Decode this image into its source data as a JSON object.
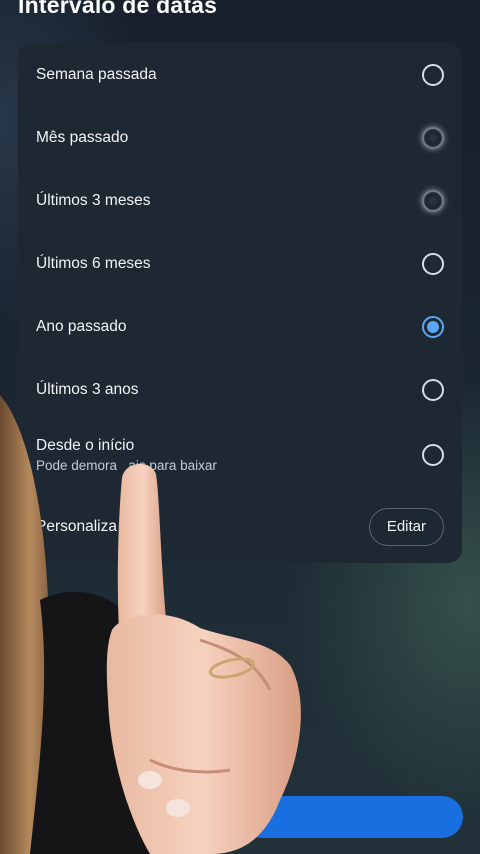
{
  "header": {
    "title": "Intervalo de datas"
  },
  "options": [
    {
      "label": "Semana passada",
      "sublabel": "",
      "state": "off"
    },
    {
      "label": "Mês passado",
      "sublabel": "",
      "state": "blurred"
    },
    {
      "label": "Últimos 3 meses",
      "sublabel": "",
      "state": "blurred"
    },
    {
      "label": "Últimos 6 meses",
      "sublabel": "",
      "state": "off"
    },
    {
      "label": "Ano passado",
      "sublabel": "",
      "state": "selected"
    },
    {
      "label": "Últimos 3 anos",
      "sublabel": "",
      "state": "off"
    },
    {
      "label": "Desde o início",
      "sublabel": "Pode demora   ais para baixar",
      "state": "off"
    }
  ],
  "custom": {
    "label": "Personaliza",
    "edit_label": "Editar"
  },
  "colors": {
    "accent": "#5aa6f5",
    "card": "#1e2833",
    "primary_button": "#1a6fe0"
  }
}
